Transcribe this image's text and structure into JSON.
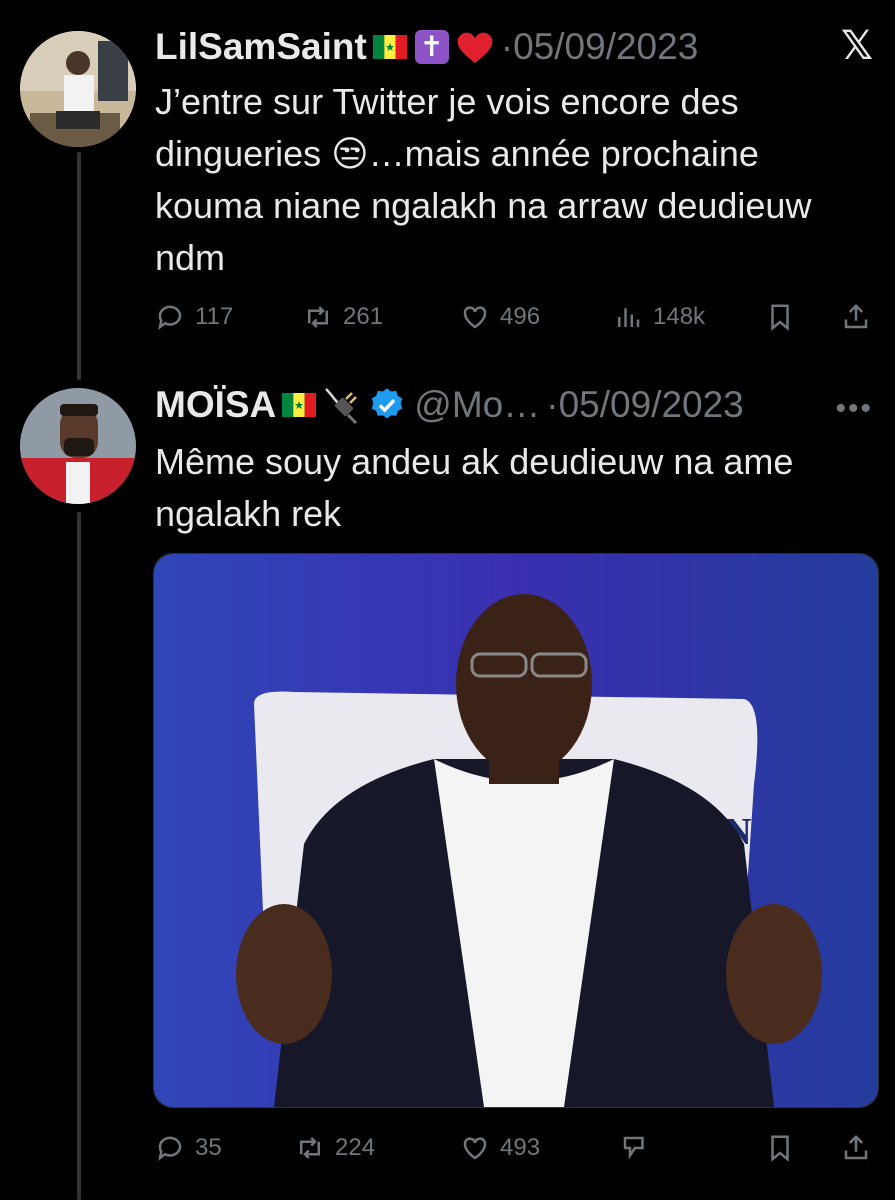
{
  "tweets": [
    {
      "display_name": "LilSamSaint",
      "separator": "·",
      "date": "05/09/2023",
      "text": "J’entre sur Twitter je vois encore des dingueries 😒…mais année prochaine kouma niane ngalakh na arraw deudieuw ndm",
      "actions": {
        "replies": "117",
        "retweets": "261",
        "likes": "496",
        "views": "148k"
      }
    },
    {
      "display_name": "MOÏSA",
      "handle": "@Mo…",
      "separator": "·",
      "date": "05/09/2023",
      "text": "Même souy andeu ak deudieuw na ame ngalakh rek",
      "media_alt": "",
      "media_caption_fragment": "TIN",
      "actions": {
        "replies": "35",
        "retweets": "224",
        "likes": "493"
      }
    }
  ],
  "icons": {
    "header": [
      "x-logo-icon",
      "more-options-icon"
    ],
    "actions": [
      "reply-icon",
      "retweet-icon",
      "like-icon",
      "views-icon",
      "bookmark-icon",
      "share-icon",
      "grok-icon"
    ]
  },
  "colors": {
    "background": "#000000",
    "text": "#e7e9ea",
    "muted": "#71767b",
    "verified": "#1d9bf0",
    "thread_line": "#333639"
  }
}
